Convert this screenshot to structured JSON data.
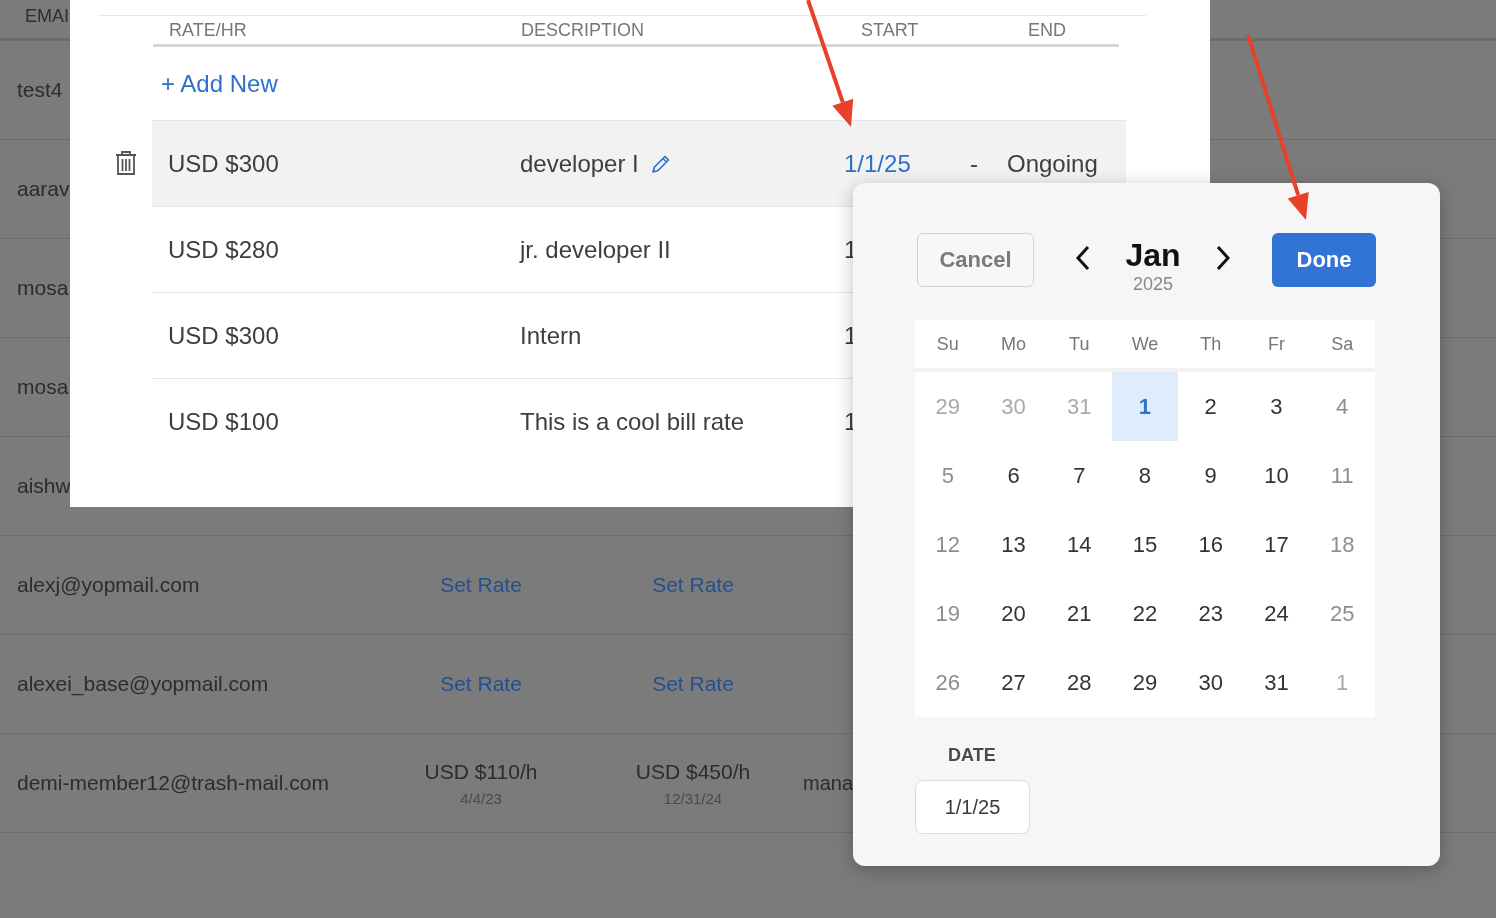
{
  "background_table": {
    "header": "EMAI",
    "rows": [
      {
        "email": "test4"
      },
      {
        "email": "aarav"
      },
      {
        "email": "mosa"
      },
      {
        "email": "mosa"
      },
      {
        "email": "aishw"
      },
      {
        "email": "alexj@yopmail.com",
        "column_2": {
          "kind": "link",
          "text": "Set Rate"
        },
        "column_3": {
          "kind": "link",
          "text": "Set Rate"
        }
      },
      {
        "email": "alexei_base@yopmail.com",
        "column_2": {
          "kind": "link",
          "text": "Set Rate"
        },
        "column_3": {
          "kind": "link",
          "text": "Set Rate"
        }
      },
      {
        "email": "demi-member12@trash-mail.com",
        "column_2": {
          "kind": "rate",
          "text": "USD $110/h",
          "date": "4/4/23"
        },
        "column_3": {
          "kind": "rate",
          "text": "USD $450/h",
          "date": "12/31/24"
        },
        "column_4": "mana"
      }
    ]
  },
  "modal": {
    "columns": [
      "RATE/HR",
      "DESCRIPTION",
      "START",
      "END"
    ],
    "add_button": "+ Add New",
    "rows": [
      {
        "rate": "USD $300",
        "description": "developer I",
        "editable": true,
        "start": "1/1/25",
        "separator": "-",
        "end": "Ongoing",
        "selected": true
      },
      {
        "rate": "USD $280",
        "description": "jr. developer II",
        "editable": false,
        "start": "1",
        "selected": false
      },
      {
        "rate": "USD $300",
        "description": "Intern",
        "editable": false,
        "start": "1",
        "selected": false
      },
      {
        "rate": "USD $100",
        "description": "This is a cool bill rate",
        "editable": false,
        "start": "1",
        "selected": false
      }
    ]
  },
  "date_picker": {
    "cancel": "Cancel",
    "month": "Jan",
    "year": "2025",
    "done": "Done",
    "weekdays": [
      "Su",
      "Mo",
      "Tu",
      "We",
      "Th",
      "Fr",
      "Sa"
    ],
    "weeks": [
      [
        {
          "label": "29",
          "outside": true,
          "selected": false
        },
        {
          "label": "30",
          "outside": true,
          "selected": false
        },
        {
          "label": "31",
          "outside": true,
          "selected": false
        },
        {
          "label": "1",
          "outside": false,
          "selected": true
        },
        {
          "label": "2",
          "outside": false,
          "selected": false
        },
        {
          "label": "3",
          "outside": false,
          "selected": false
        },
        {
          "label": "4",
          "outside": false,
          "selected": false
        }
      ],
      [
        {
          "label": "5",
          "outside": false,
          "selected": false
        },
        {
          "label": "6",
          "outside": false,
          "selected": false
        },
        {
          "label": "7",
          "outside": false,
          "selected": false
        },
        {
          "label": "8",
          "outside": false,
          "selected": false
        },
        {
          "label": "9",
          "outside": false,
          "selected": false
        },
        {
          "label": "10",
          "outside": false,
          "selected": false
        },
        {
          "label": "11",
          "outside": false,
          "selected": false
        }
      ],
      [
        {
          "label": "12",
          "outside": false,
          "selected": false
        },
        {
          "label": "13",
          "outside": false,
          "selected": false
        },
        {
          "label": "14",
          "outside": false,
          "selected": false
        },
        {
          "label": "15",
          "outside": false,
          "selected": false
        },
        {
          "label": "16",
          "outside": false,
          "selected": false
        },
        {
          "label": "17",
          "outside": false,
          "selected": false
        },
        {
          "label": "18",
          "outside": false,
          "selected": false
        }
      ],
      [
        {
          "label": "19",
          "outside": false,
          "selected": false
        },
        {
          "label": "20",
          "outside": false,
          "selected": false
        },
        {
          "label": "21",
          "outside": false,
          "selected": false
        },
        {
          "label": "22",
          "outside": false,
          "selected": false
        },
        {
          "label": "23",
          "outside": false,
          "selected": false
        },
        {
          "label": "24",
          "outside": false,
          "selected": false
        },
        {
          "label": "25",
          "outside": false,
          "selected": false
        }
      ],
      [
        {
          "label": "26",
          "outside": false,
          "selected": false
        },
        {
          "label": "27",
          "outside": false,
          "selected": false
        },
        {
          "label": "28",
          "outside": false,
          "selected": false
        },
        {
          "label": "29",
          "outside": false,
          "selected": false
        },
        {
          "label": "30",
          "outside": false,
          "selected": false
        },
        {
          "label": "31",
          "outside": false,
          "selected": false
        },
        {
          "label": "1",
          "outside": true,
          "selected": false
        }
      ]
    ],
    "date_label": "DATE",
    "date_value": "1/1/25"
  }
}
